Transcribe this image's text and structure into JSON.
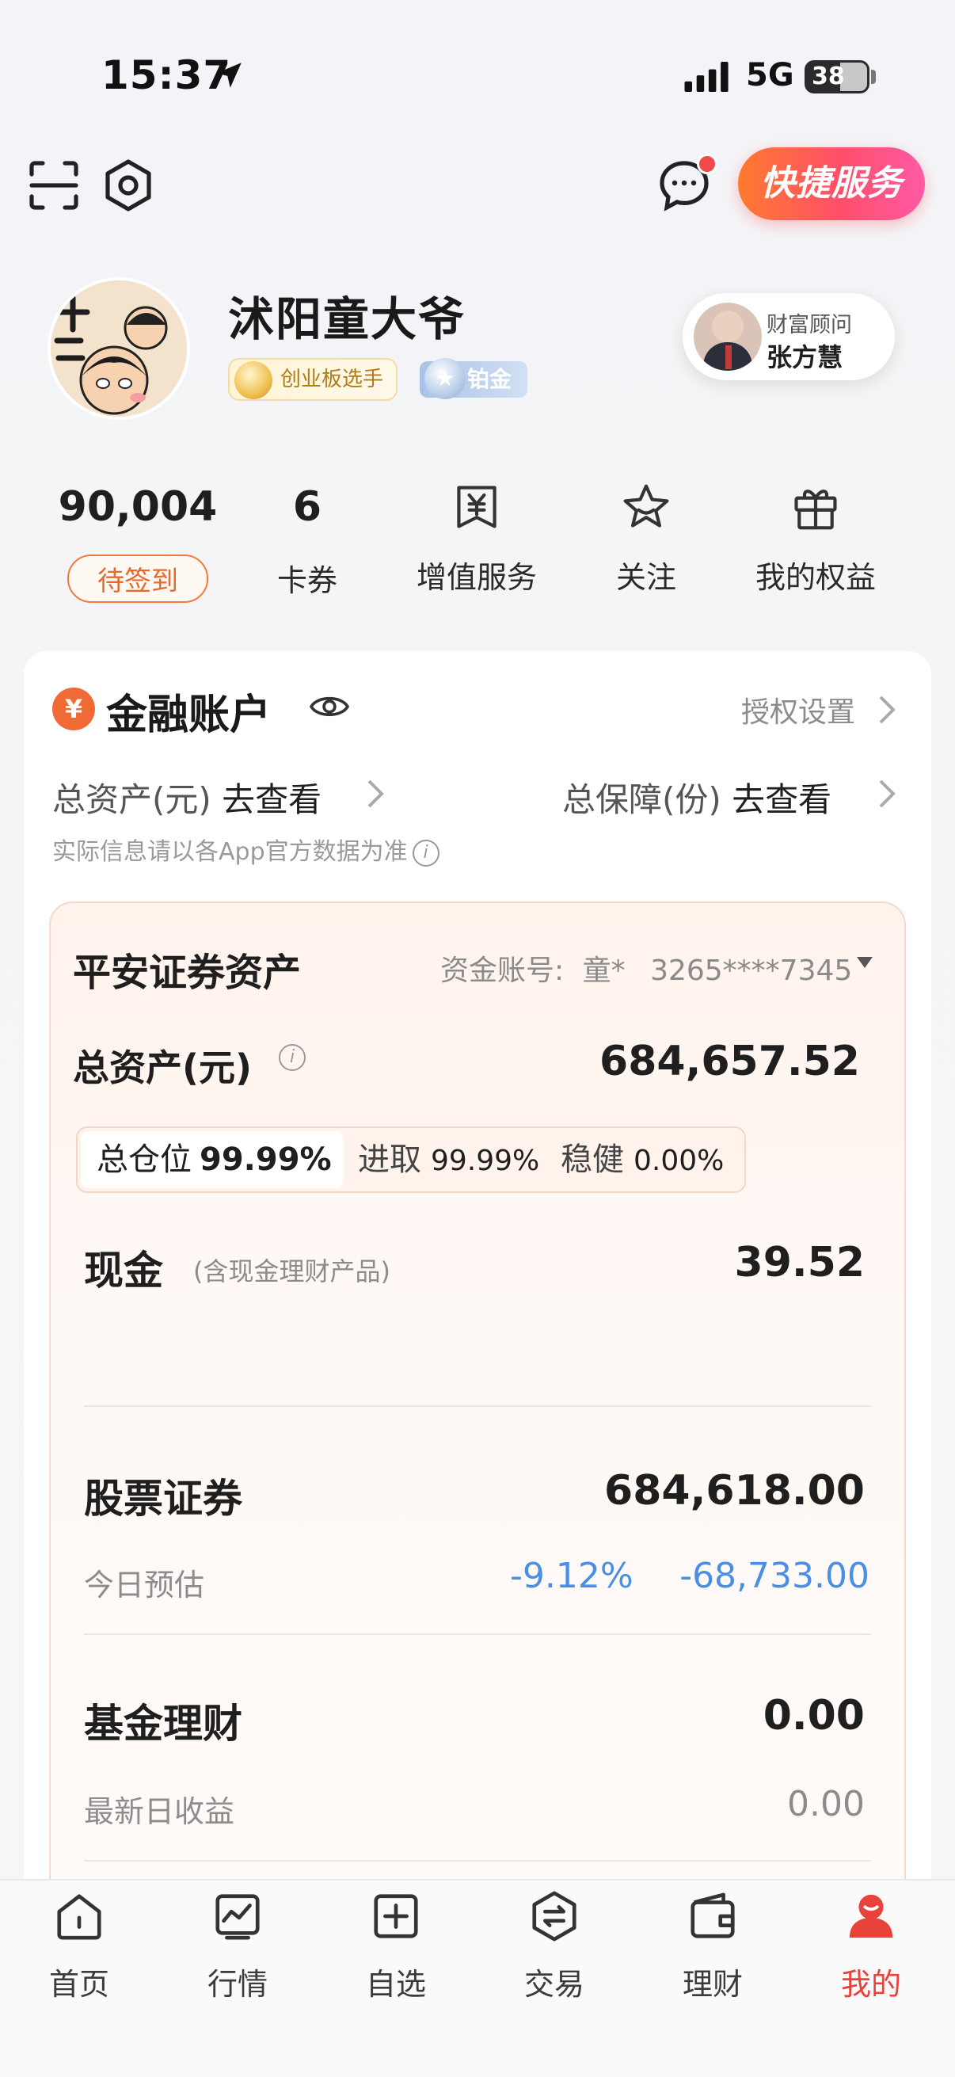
{
  "status_bar": {
    "time": "15:37",
    "network": "5G",
    "battery": "38"
  },
  "header": {
    "quick_service_label": "快捷服务"
  },
  "profile": {
    "username": "沭阳童大爷",
    "badge_level": "创业板选手",
    "badge_tier": "铂金",
    "advisor_title": "财富顾问",
    "advisor_name": "张方慧"
  },
  "stats": [
    {
      "value": "90,004",
      "label": "待签到"
    },
    {
      "value": "6",
      "label": "卡券"
    },
    {
      "icon": "yuan-ticket-icon",
      "label": "增值服务"
    },
    {
      "icon": "star-icon",
      "label": "关注"
    },
    {
      "icon": "gift-icon",
      "label": "我的权益"
    }
  ],
  "finance": {
    "icon_glyph": "¥",
    "title": "金融账户",
    "auth_link": "授权设置",
    "total_assets_prefix": "总资产(元)",
    "total_assets_action": "去查看",
    "guarantee_prefix": "总保障(份)",
    "guarantee_action": "去查看",
    "disclaimer": "实际信息请以各App官方数据为准"
  },
  "securities": {
    "title": "平安证券资产",
    "account_label": "资金账号:",
    "account_name": "童*",
    "account_number": "3265****7345",
    "total_assets_label": "总资产(元)",
    "total_assets_value": "684,657.52",
    "position_label": "总仓位",
    "position_value": "99.99%",
    "aggressive_label": "进取",
    "aggressive_value": "99.99%",
    "stable_label": "稳健",
    "stable_value": "0.00%",
    "cash_label": "现金",
    "cash_note": "(含现金理财产品)",
    "cash_value": "39.52",
    "stocks_label": "股票证券",
    "stocks_value": "684,618.00",
    "today_label": "今日预估",
    "today_pct": "-9.12%",
    "today_amount": "-68,733.00",
    "funds_label": "基金理财",
    "funds_value": "0.00",
    "latest_label": "最新日收益",
    "latest_value": "0.00"
  },
  "tabs": [
    {
      "label": "首页",
      "icon": "home-icon"
    },
    {
      "label": "行情",
      "icon": "chart-icon"
    },
    {
      "label": "自选",
      "icon": "add-icon"
    },
    {
      "label": "交易",
      "icon": "trade-icon"
    },
    {
      "label": "理财",
      "icon": "wallet-icon"
    },
    {
      "label": "我的",
      "icon": "profile-icon",
      "active": true
    }
  ],
  "colors": {
    "accent": "#e8423a",
    "orange": "#ef6a35",
    "negative": "#4a8ee6"
  }
}
